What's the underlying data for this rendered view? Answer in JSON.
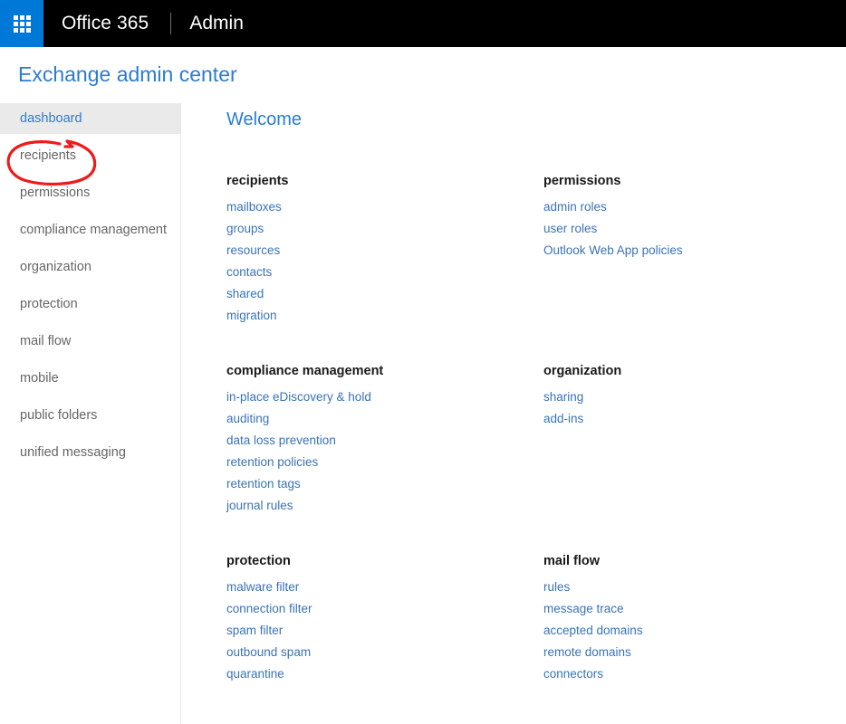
{
  "suite": {
    "waffle_icon": "app-launcher-waffle-icon",
    "brand": "Office 365",
    "app": "Admin"
  },
  "page": {
    "title": "Exchange admin center"
  },
  "left_nav": {
    "items": [
      {
        "label": "dashboard",
        "selected": true
      },
      {
        "label": "recipients",
        "selected": false,
        "annotated": true
      },
      {
        "label": "permissions",
        "selected": false
      },
      {
        "label": "compliance management",
        "selected": false
      },
      {
        "label": "organization",
        "selected": false
      },
      {
        "label": "protection",
        "selected": false
      },
      {
        "label": "mail flow",
        "selected": false
      },
      {
        "label": "mobile",
        "selected": false
      },
      {
        "label": "public folders",
        "selected": false
      },
      {
        "label": "unified messaging",
        "selected": false
      }
    ]
  },
  "annotation": {
    "shape": "red-ellipse-circle-around-recipients",
    "color": "#ef1a1a",
    "targets": "recipients"
  },
  "main": {
    "welcome": "Welcome",
    "tiles": [
      {
        "heading": "recipients",
        "links": [
          "mailboxes",
          "groups",
          "resources",
          "contacts",
          "shared",
          "migration"
        ]
      },
      {
        "heading": "permissions",
        "links": [
          "admin roles",
          "user roles",
          "Outlook Web App policies"
        ]
      },
      {
        "heading": "compliance management",
        "links": [
          "in-place eDiscovery & hold",
          "auditing",
          "data loss prevention",
          "retention policies",
          "retention tags",
          "journal rules"
        ]
      },
      {
        "heading": "organization",
        "links": [
          "sharing",
          "add-ins"
        ]
      },
      {
        "heading": "protection",
        "links": [
          "malware filter",
          "connection filter",
          "spam filter",
          "outbound spam",
          "quarantine"
        ]
      },
      {
        "heading": "mail flow",
        "links": [
          "rules",
          "message trace",
          "accepted domains",
          "remote domains",
          "connectors"
        ]
      }
    ]
  },
  "colors": {
    "suite_bar": "#000000",
    "waffle_tile": "#0078d7",
    "accent_blue": "#2b7cd3",
    "link_blue": "#3a73b8",
    "nav_text": "#666666",
    "nav_selected_bg": "#eaeaea",
    "annotation_red": "#ef1a1a"
  }
}
